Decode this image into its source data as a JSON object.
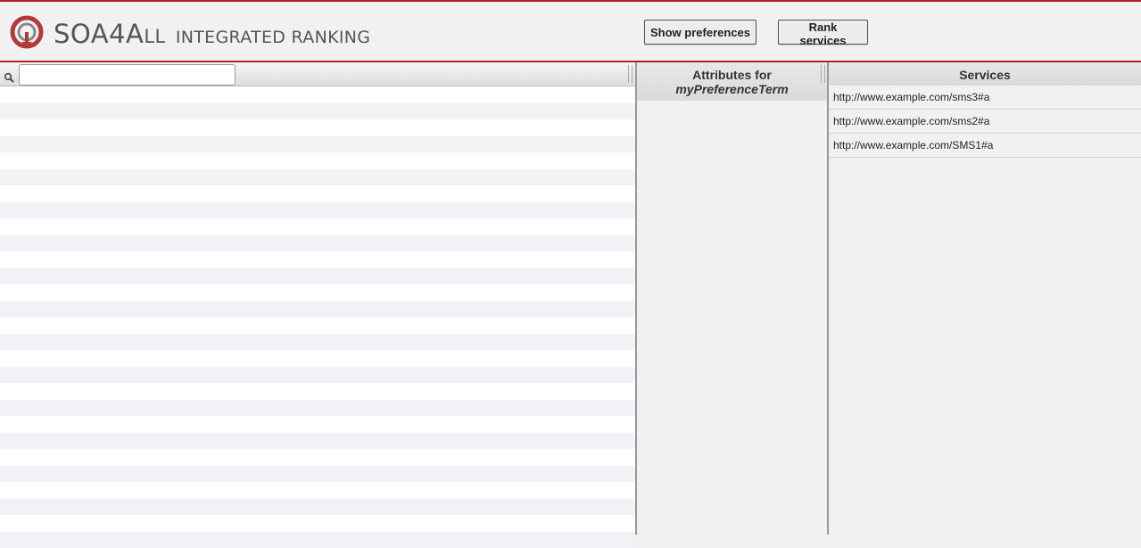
{
  "brand": {
    "main": "SOA4All",
    "main_lead": "SOA4A",
    "main_tail": "LL",
    "sub": "INTEGRATED RANKING"
  },
  "header": {
    "show_preferences_label": "Show preferences",
    "rank_services_label": "Rank services"
  },
  "search": {
    "value": "",
    "placeholder": ""
  },
  "attributes": {
    "title": "Attributes for",
    "term": "myPreferenceTerm"
  },
  "services": {
    "title": "Services",
    "items": [
      "http://www.example.com/sms3#a",
      "http://www.example.com/sms2#a",
      "http://www.example.com/SMS1#a"
    ]
  },
  "colors": {
    "accent": "#b22222",
    "logo": "#c0392b",
    "stripe": "#f1f2f6"
  },
  "icons": {
    "logo": "soa4all-logo-icon",
    "search": "search-icon"
  }
}
